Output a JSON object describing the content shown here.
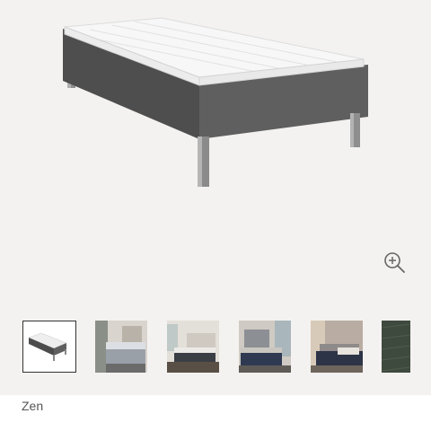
{
  "product": {
    "name": "Zen"
  },
  "gallery": {
    "zoom_icon": "zoom-in-icon",
    "thumbnails": [
      {
        "name": "thumbnail-bed-frame",
        "selected": true
      },
      {
        "name": "thumbnail-bedroom-1",
        "selected": false
      },
      {
        "name": "thumbnail-bedroom-2",
        "selected": false
      },
      {
        "name": "thumbnail-bedroom-3",
        "selected": false
      },
      {
        "name": "thumbnail-bedroom-4",
        "selected": false
      },
      {
        "name": "thumbnail-fabric-swatch",
        "selected": false
      }
    ]
  },
  "colors": {
    "background": "#f4f2f0",
    "fabric": "#5b5b5b",
    "mattress": "#f2f2f2",
    "legs": "#9a9a9a",
    "swatch": "#3e4a3e"
  }
}
